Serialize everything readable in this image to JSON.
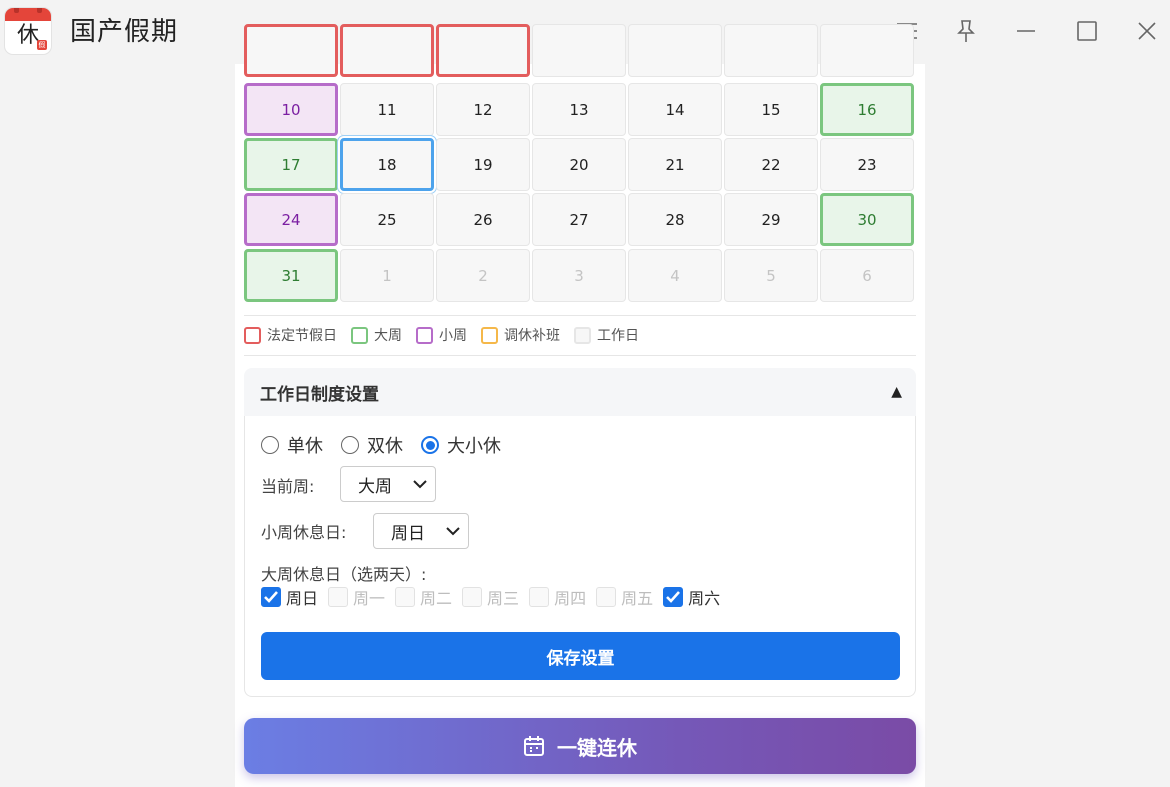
{
  "app": {
    "title": "国产假期",
    "icon_glyph": "休",
    "icon_badge": "假"
  },
  "window_controls": [
    "menu-icon",
    "pin-icon",
    "minimize-icon",
    "maximize-icon",
    "close-icon"
  ],
  "calendar": {
    "rows": [
      [
        {
          "day": "",
          "type": "holiday"
        },
        {
          "day": "",
          "type": "holiday"
        },
        {
          "day": "",
          "type": "holiday"
        },
        {
          "day": "",
          "type": "normal"
        },
        {
          "day": "",
          "type": "normal"
        },
        {
          "day": "",
          "type": "normal"
        },
        {
          "day": "",
          "type": "normal"
        }
      ],
      [
        {
          "day": "10",
          "type": "small"
        },
        {
          "day": "11",
          "type": "normal"
        },
        {
          "day": "12",
          "type": "normal"
        },
        {
          "day": "13",
          "type": "normal"
        },
        {
          "day": "14",
          "type": "normal"
        },
        {
          "day": "15",
          "type": "normal"
        },
        {
          "day": "16",
          "type": "big"
        }
      ],
      [
        {
          "day": "17",
          "type": "big"
        },
        {
          "day": "18",
          "type": "selected"
        },
        {
          "day": "19",
          "type": "normal"
        },
        {
          "day": "20",
          "type": "normal"
        },
        {
          "day": "21",
          "type": "normal"
        },
        {
          "day": "22",
          "type": "normal"
        },
        {
          "day": "23",
          "type": "normal"
        }
      ],
      [
        {
          "day": "24",
          "type": "small"
        },
        {
          "day": "25",
          "type": "normal"
        },
        {
          "day": "26",
          "type": "normal"
        },
        {
          "day": "27",
          "type": "normal"
        },
        {
          "day": "28",
          "type": "normal"
        },
        {
          "day": "29",
          "type": "normal"
        },
        {
          "day": "30",
          "type": "big"
        }
      ],
      [
        {
          "day": "31",
          "type": "big"
        },
        {
          "day": "1",
          "type": "other"
        },
        {
          "day": "2",
          "type": "other"
        },
        {
          "day": "3",
          "type": "other"
        },
        {
          "day": "4",
          "type": "other"
        },
        {
          "day": "5",
          "type": "other"
        },
        {
          "day": "6",
          "type": "other"
        }
      ]
    ]
  },
  "legend": [
    {
      "label": "法定节假日",
      "color": "#e35d5d",
      "bg": "#ffffff"
    },
    {
      "label": "大周",
      "color": "#7bc67f",
      "bg": "#ffffff"
    },
    {
      "label": "小周",
      "color": "#b66cc9",
      "bg": "#ffffff"
    },
    {
      "label": "调休补班",
      "color": "#f5b84a",
      "bg": "#ffffff"
    },
    {
      "label": "工作日",
      "color": "#e6e6e6",
      "bg": "#f7f7f7"
    }
  ],
  "settings": {
    "title": "工作日制度设置",
    "modes": [
      {
        "label": "单休",
        "selected": false
      },
      {
        "label": "双休",
        "selected": false
      },
      {
        "label": "大小休",
        "selected": true
      }
    ],
    "current_week_label": "当前周:",
    "current_week_value": "大周",
    "small_week_rest_label": "小周休息日:",
    "small_week_rest_value": "周日",
    "big_week_rest_label": "大周休息日（选两天）:",
    "days": [
      {
        "label": "周日",
        "checked": true,
        "disabled": false
      },
      {
        "label": "周一",
        "checked": false,
        "disabled": true
      },
      {
        "label": "周二",
        "checked": false,
        "disabled": true
      },
      {
        "label": "周三",
        "checked": false,
        "disabled": true
      },
      {
        "label": "周四",
        "checked": false,
        "disabled": true
      },
      {
        "label": "周五",
        "checked": false,
        "disabled": true
      },
      {
        "label": "周六",
        "checked": true,
        "disabled": false
      }
    ],
    "save_label": "保存设置"
  },
  "one_click": {
    "label": "一键连休",
    "icon": "calendar-icon"
  },
  "colors": {
    "accent": "#1a73e8",
    "big_week": "#7bc67f",
    "small_week": "#b66cc9",
    "holiday": "#e35d5d",
    "makeup": "#f5b84a"
  }
}
